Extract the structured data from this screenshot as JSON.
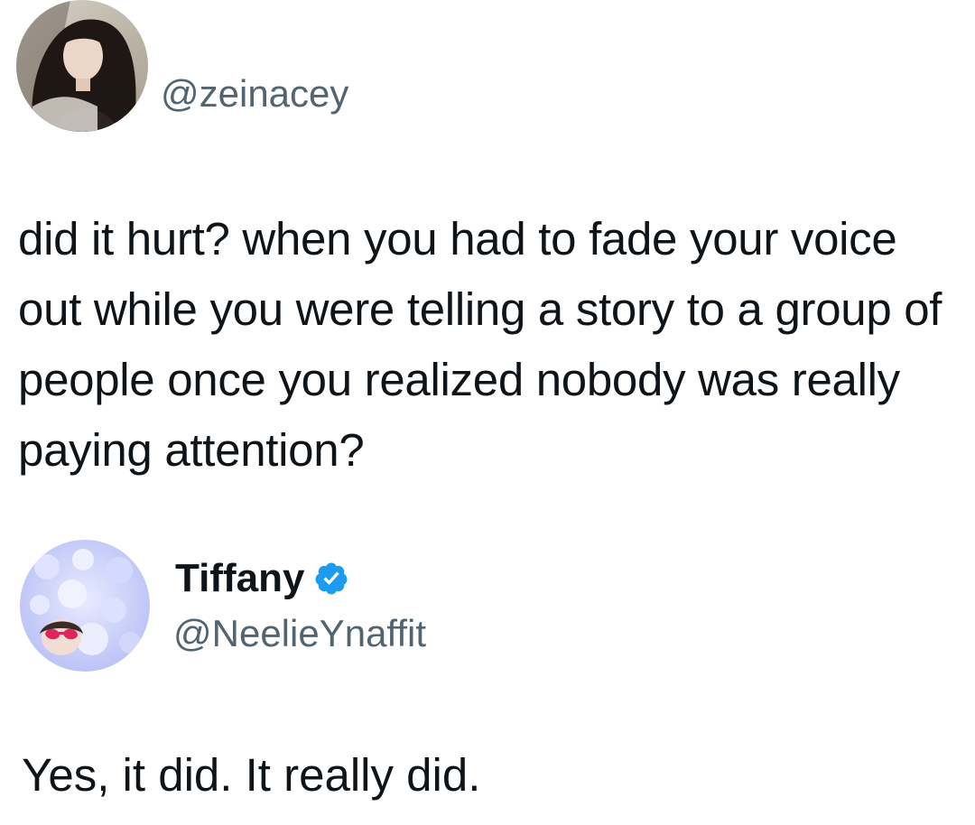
{
  "original_tweet": {
    "avatar_icon": "user-avatar-photo",
    "handle": "@zeinacey",
    "text": "did it hurt? when you had to fade your voice out while you were telling a story to a group of people once you realized nobody was really paying attention?"
  },
  "reply_tweet": {
    "avatar_icon": "user-avatar-photo",
    "display_name": "Tiffany",
    "verified_icon": "verified-badge-icon",
    "verified_color": "#1d9bf0",
    "handle": "@NeelieYnaffit",
    "text": "Yes, it did. It really did."
  },
  "colors": {
    "text_primary": "#0f1419",
    "text_secondary": "#536471",
    "background": "#ffffff"
  }
}
